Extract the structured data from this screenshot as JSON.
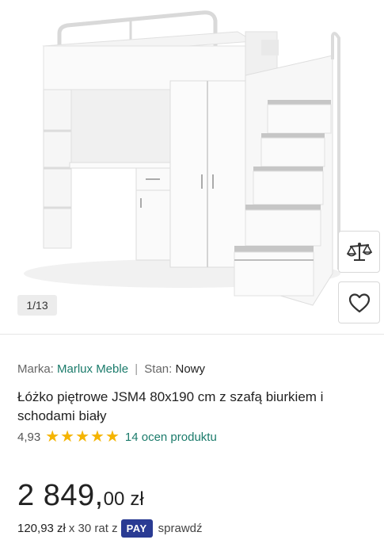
{
  "gallery": {
    "counter": "1/13",
    "compare_icon": "scale-icon",
    "wishlist_icon": "heart-icon"
  },
  "product": {
    "brand_label": "Marka:",
    "brand": "Marlux Meble",
    "separator": "|",
    "condition_label": "Stan:",
    "condition": "Nowy",
    "title": "Łóżko piętrowe JSM4 80x190 cm z szafą biurkiem i schodami biały",
    "rating_value": "4,93",
    "rating_stars": 5,
    "reviews": "14 ocen produktu"
  },
  "price": {
    "integer": "2 849,",
    "decimal": "00",
    "currency": "zł"
  },
  "installment": {
    "amount": "120,93 zł",
    "text": "x 30 rat z",
    "badge": "PAY",
    "link": "sprawdź"
  },
  "colors": {
    "accent": "#1b7b6b",
    "star": "#f5b400",
    "pay_badge": "#2a3b93"
  }
}
